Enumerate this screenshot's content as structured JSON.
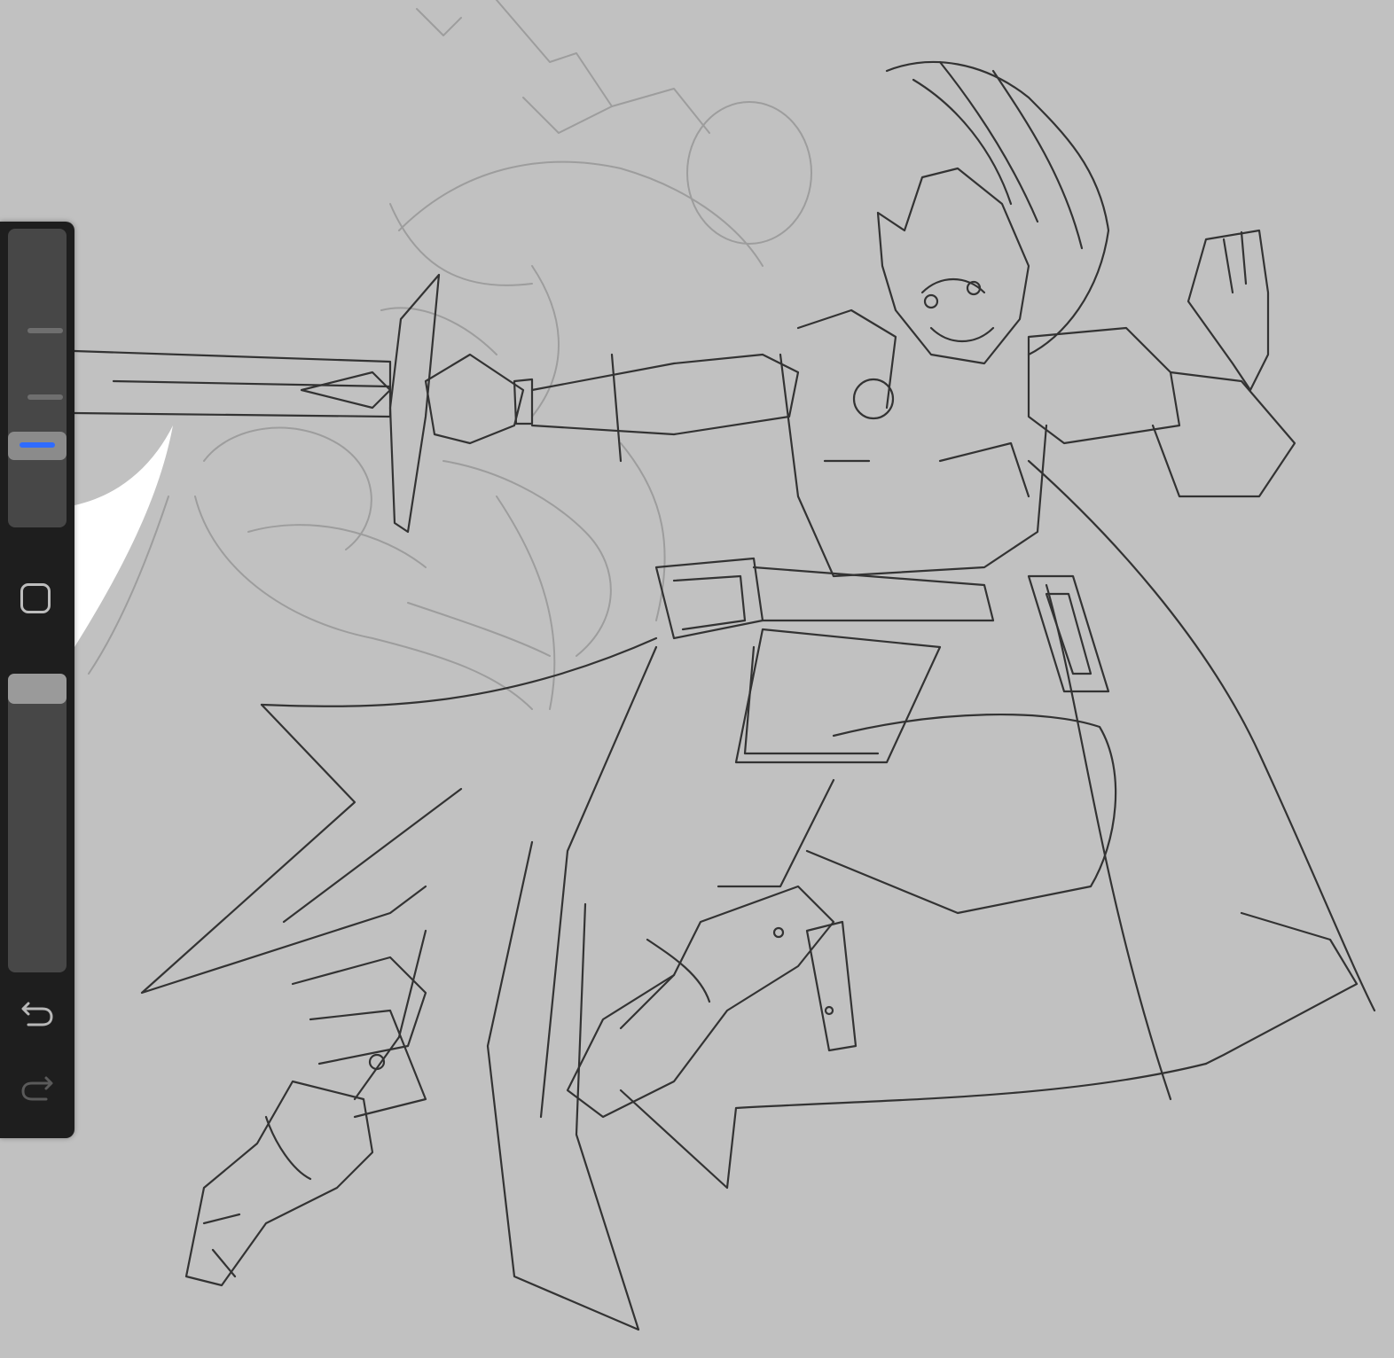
{
  "app": {
    "canvas_background": "#c1c1c1",
    "sidebar_background": "#1e1e1e",
    "accent_color": "#2f6bff"
  },
  "sidebar": {
    "brush_size_slider": {
      "level": 0.72
    },
    "modify_button_icon": "square-outline-icon",
    "opacity_slider": {
      "level": 1.0
    },
    "undo_icon": "undo-arrow-icon",
    "redo_icon": "redo-arrow-icon",
    "redo_enabled": false
  },
  "canvas": {
    "content": "pencil-sketch-artwork"
  }
}
